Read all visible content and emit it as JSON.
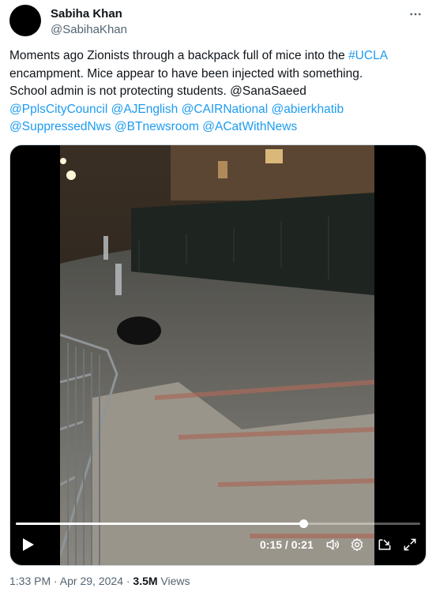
{
  "author": {
    "name": "Sabiha Khan",
    "handle": "@SabihaKhan"
  },
  "tweet": {
    "line1_pre": "Moments ago Zionists through a backpack full of mice into the ",
    "line1_hashtag": "#UCLA",
    "line2": "encampment. Mice appear to have been injected with something.",
    "line3": "School admin  is not protecting students. @SanaSaeed",
    "mentions_line4": [
      "@PplsCityCouncil",
      "@AJEnglish",
      "@CAIRNational",
      "@abierkhatib"
    ],
    "mentions_line5": [
      "@SuppressedNws",
      "@BTnewsroom",
      "@ACatWithNews"
    ]
  },
  "video": {
    "current_time": "0:15",
    "separator": " / ",
    "duration": "0:21",
    "progress_fraction": 0.71
  },
  "meta": {
    "timestamp": "1:33 PM · Apr 29, 2024 · ",
    "views_count": "3.5M",
    "views_label": " Views"
  },
  "icons": {
    "more": "more-horizontal-icon",
    "play": "play-icon",
    "volume": "volume-icon",
    "settings": "gear-icon",
    "pip": "picture-in-picture-icon",
    "fullscreen": "fullscreen-icon"
  },
  "colors": {
    "link": "#1d9bf0",
    "secondary_text": "#536471",
    "primary_text": "#0f1419"
  }
}
